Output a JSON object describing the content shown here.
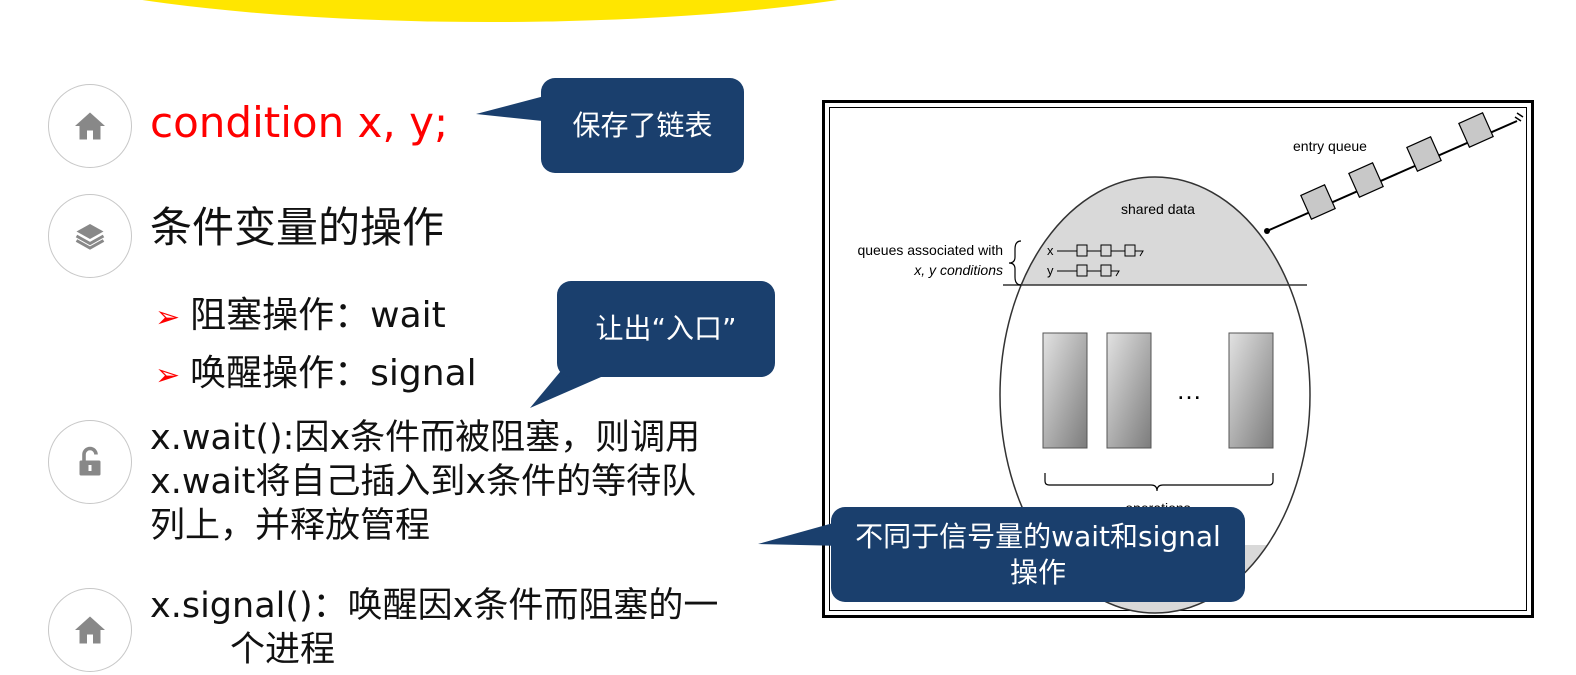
{
  "slide": {
    "items": [
      {
        "icon": "home-icon",
        "text": "condition x, y;"
      },
      {
        "icon": "layers-icon",
        "text": "条件变量的操作"
      },
      {
        "icon": "unlock-icon",
        "lines": [
          "x.wait():因x条件而被阻塞，则调用",
          "x.wait将自己插入到x条件的等待队",
          "列上，并释放管程"
        ]
      },
      {
        "icon": "home-icon",
        "lines": [
          "x.signal()：唤醒因x条件而阻塞的一",
          "个进程"
        ]
      }
    ],
    "sub_items": [
      {
        "marker": "➢",
        "text": "阻塞操作：wait"
      },
      {
        "marker": "➢",
        "text": "唤醒操作：signal"
      }
    ]
  },
  "callouts": [
    {
      "text": "保存了链表"
    },
    {
      "text": "让出“入口”"
    },
    {
      "lines": [
        "不同于信号量的wait和signal",
        "操作"
      ]
    }
  ],
  "diagram": {
    "entry_queue": "entry queue",
    "shared_data": "shared data",
    "queues_label_1": "queues associated with",
    "queues_label_2": "x, y conditions",
    "x_label": "x",
    "y_label": "y",
    "ellipsis": "…",
    "operations": "operations"
  },
  "colors": {
    "banner": "#ffe600",
    "callout": "#1a3f6d",
    "accent_red": "#ff0000"
  }
}
